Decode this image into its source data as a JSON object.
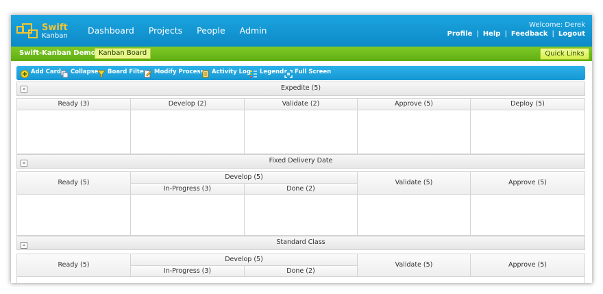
{
  "header": {
    "logo": {
      "line1": "Swift",
      "line2": "Kanban"
    },
    "nav": [
      "Dashboard",
      "Projects",
      "People",
      "Admin"
    ],
    "welcome": "Welcome: Derek",
    "links": [
      "Profile",
      "Help",
      "Feedback",
      "Logout"
    ]
  },
  "breadcrumb": {
    "project": "Swift-Kanban Demo",
    "separator": "»",
    "current": "Kanban Board",
    "quick_links": "Quick Links"
  },
  "toolbar": {
    "items": [
      {
        "label": "Add Card",
        "icon": "add-icon"
      },
      {
        "label": "Collapse",
        "icon": "collapse-icon"
      },
      {
        "label": "Board Filter",
        "icon": "filter-icon"
      },
      {
        "label": "Modify Process",
        "icon": "edit-icon"
      },
      {
        "label": "Activity Log",
        "icon": "log-icon"
      },
      {
        "label": "Legend",
        "icon": "legend-icon"
      },
      {
        "label": "Full Screen",
        "icon": "fullscreen-icon"
      }
    ]
  },
  "expand_glyph": "»",
  "lanes": {
    "expedite": {
      "title": "Expedite (5)",
      "columns": [
        "Ready (3)",
        "Develop (2)",
        "Validate (2)",
        "Approve (5)",
        "Deploy (5)"
      ]
    },
    "fixed": {
      "title": "Fixed Delivery Date",
      "ready": "Ready (5)",
      "develop": "Develop (5)",
      "in_progress": "In-Progress (3)",
      "done": "Done (2)",
      "validate": "Validate (5)",
      "approve": "Approve (5)"
    },
    "standard": {
      "title": "Standard Class",
      "ready": "Ready (5)",
      "develop": "Develop (5)",
      "in_progress": "In-Progress (3)",
      "done": "Done (2)",
      "validate": "Validate (5)",
      "approve": "Approve (5)"
    }
  },
  "colors": {
    "header_blue": "#1ba4df",
    "bar_green": "#6dbd1a",
    "logo_orange": "#f7c531"
  }
}
